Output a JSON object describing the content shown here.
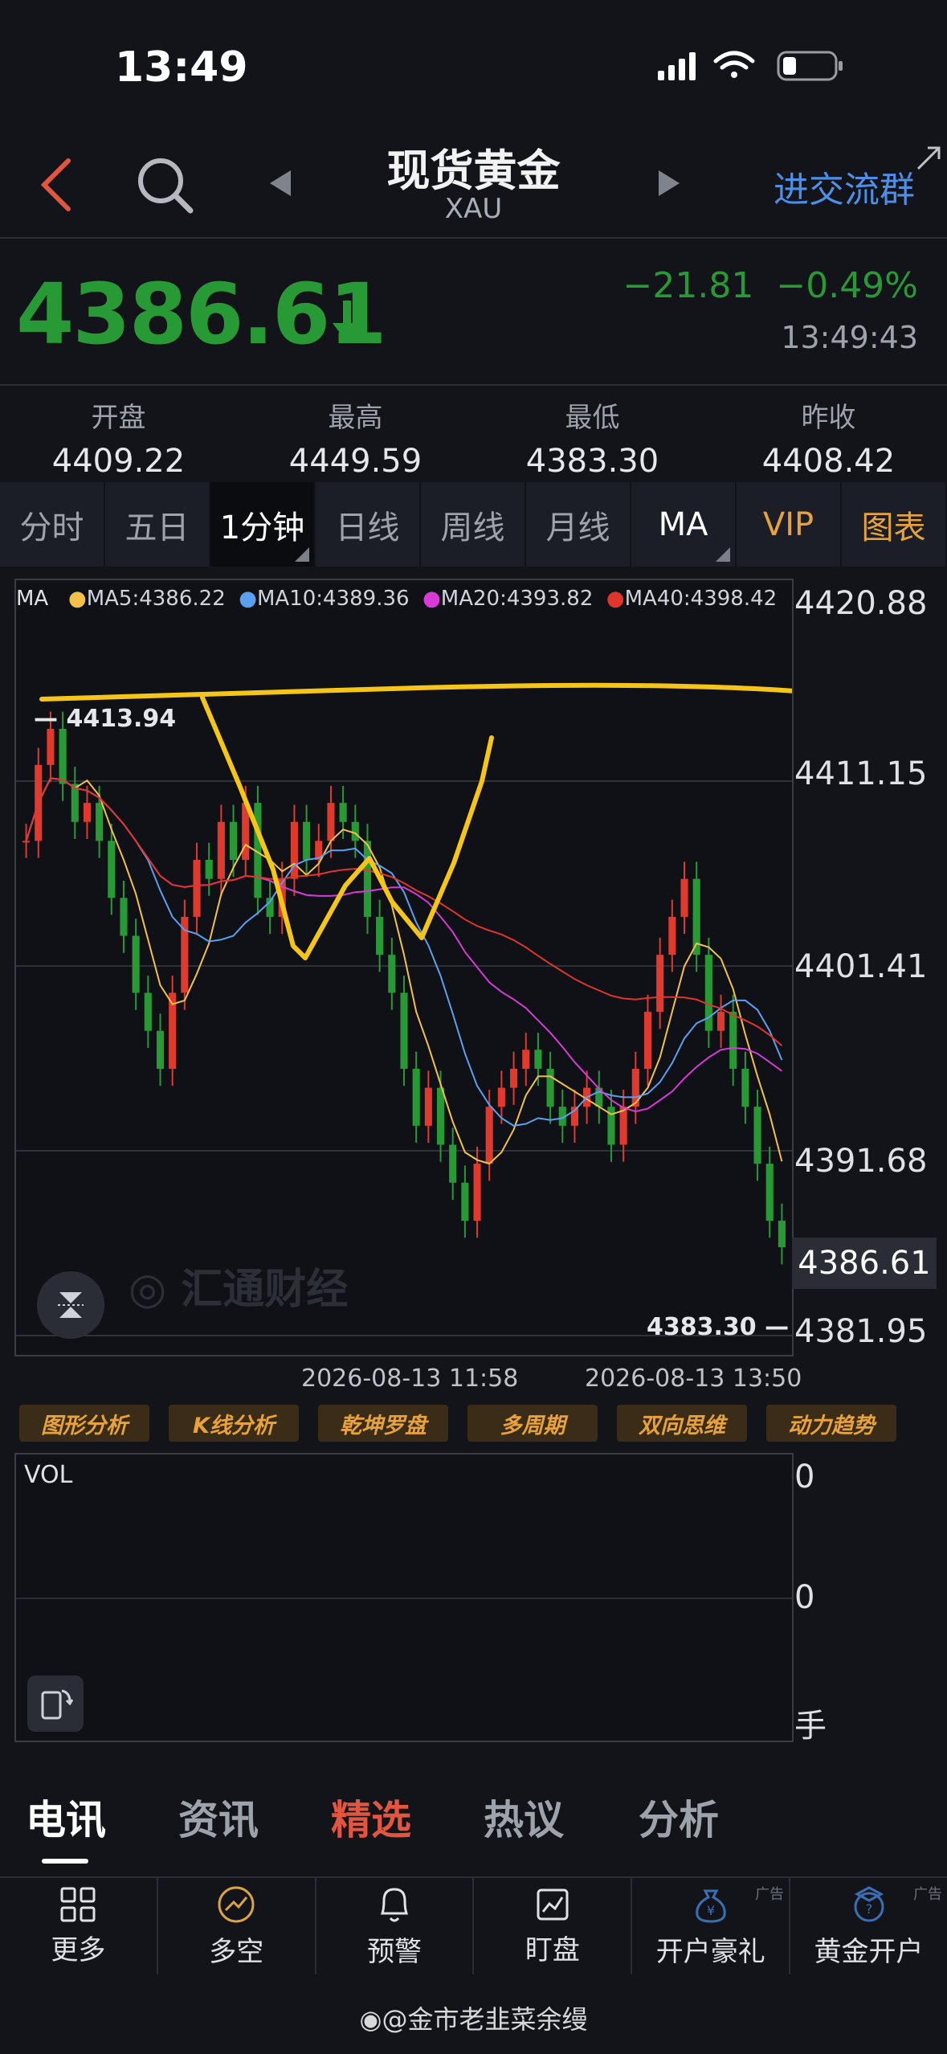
{
  "status_bar": {
    "time": "13:49"
  },
  "nav": {
    "title": "现货黄金",
    "subtitle": "XAU",
    "join_group": "进交流群"
  },
  "quote": {
    "price": "4386.61",
    "arrow": "↓",
    "change": "−21.81",
    "change_pct": "−0.49%",
    "time": "13:49:43",
    "stats": [
      {
        "label": "开盘",
        "value": "4409.22"
      },
      {
        "label": "最高",
        "value": "4449.59"
      },
      {
        "label": "最低",
        "value": "4383.30"
      },
      {
        "label": "昨收",
        "value": "4408.42"
      }
    ]
  },
  "period_tabs": [
    "分时",
    "五日",
    "1分钟",
    "日线",
    "周线",
    "月线",
    "MA",
    "VIP",
    "图表"
  ],
  "active_period": "1分钟",
  "colors": {
    "down": "#279a35",
    "up": "#e03a2e",
    "accent": "#4d8fe6",
    "highlight": "#f5c518",
    "vip": "#e7a23b"
  },
  "chart_data": {
    "type": "line",
    "ma_legend": [
      {
        "label": "MA",
        "color": "#dfe1e5"
      },
      {
        "label": "MA5:4386.22",
        "color": "#f3c14a"
      },
      {
        "label": "MA10:4389.36",
        "color": "#5aa0f0"
      },
      {
        "label": "MA20:4393.82",
        "color": "#d73ad6"
      },
      {
        "label": "MA40:4398.42",
        "color": "#e0352b"
      }
    ],
    "y_ticks": [
      "4420.88",
      "4411.15",
      "4401.41",
      "4391.68",
      "4381.95"
    ],
    "ylim": [
      4381.95,
      4420.88
    ],
    "current_price": "4386.61",
    "high_marker": "4413.94",
    "low_marker": "4383.30",
    "x_ticks": [
      "2026-08-13 11:58",
      "2026-08-13 13:50"
    ],
    "watermark": "汇通财经",
    "close_series": [
      4408,
      4412,
      4413.9,
      4411,
      4409,
      4410,
      4408,
      4405,
      4403,
      4400,
      4398,
      4396,
      4400,
      4404,
      4407,
      4406,
      4409,
      4407,
      4410,
      4405,
      4404,
      4406,
      4409,
      4407,
      4408,
      4410,
      4409,
      4408,
      4404,
      4402,
      4400,
      4396,
      4393,
      4395,
      4392,
      4390,
      4388,
      4391,
      4394,
      4395,
      4396,
      4397,
      4396,
      4394,
      4393,
      4394,
      4395,
      4394,
      4392,
      4394,
      4396,
      4399,
      4402,
      4404,
      4406,
      4402,
      4398,
      4399,
      4396,
      4394,
      4391,
      4388,
      4386.6
    ],
    "trend_lines": "hand-drawn"
  },
  "chart_tools": [
    "图形分析",
    "K线分析",
    "乾坤罗盘",
    "多周期",
    "双向思维",
    "动力趋势"
  ],
  "volume": {
    "label": "VOL",
    "ticks": [
      "0",
      "0",
      "手"
    ]
  },
  "news_tabs": [
    "电讯",
    "资讯",
    "精选",
    "热议",
    "分析"
  ],
  "active_news_tab": "电讯",
  "highlight_news_tab": "精选",
  "dock": [
    {
      "label": "更多",
      "icon": "grid-icon",
      "ad": ""
    },
    {
      "label": "多空",
      "icon": "trend-circle-icon",
      "ad": ""
    },
    {
      "label": "预警",
      "icon": "bell-icon",
      "ad": ""
    },
    {
      "label": "盯盘",
      "icon": "monitor-chart-icon",
      "ad": ""
    },
    {
      "label": "开户豪礼",
      "icon": "money-bag-icon",
      "ad": "广告"
    },
    {
      "label": "黄金开户",
      "icon": "gold-badge-icon",
      "ad": "广告"
    }
  ],
  "watermark_footer": "@金市老韭菜余缦"
}
